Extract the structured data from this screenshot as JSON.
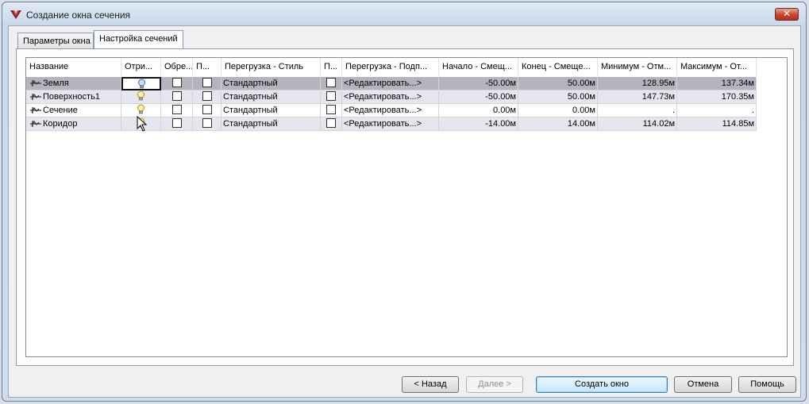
{
  "window": {
    "title": "Создание окна сечения"
  },
  "tabs": [
    {
      "label": "Параметры окна",
      "active": false
    },
    {
      "label": "Настройка сечений",
      "active": true
    }
  ],
  "table": {
    "headers": [
      "Название",
      "Отри...",
      "Обре...",
      "П...",
      "Перегрузка - Стиль",
      "П...",
      "Перегрузка - Подп...",
      "Начало - Смещ...",
      "Конец - Смеще...",
      "Минимум - Отм...",
      "Максимум - От..."
    ],
    "rows": [
      {
        "name": "Земля",
        "style": "Стандартный",
        "label": "<Редактировать...>",
        "start": "-50.00м",
        "end": "50.00м",
        "min": "128.95м",
        "max": "137.34м",
        "bulb": "on",
        "selected": true
      },
      {
        "name": "Поверхность1",
        "style": "Стандартный",
        "label": "<Редактировать...>",
        "start": "-50.00м",
        "end": "50.00м",
        "min": "147.73м",
        "max": "170.35м",
        "bulb": "on",
        "selected": false
      },
      {
        "name": "Сечение",
        "style": "Стандартный",
        "label": "<Редактировать...>",
        "start": "0.00м",
        "end": "0.00м",
        "min": ".",
        "max": ".",
        "bulb": "on",
        "selected": false
      },
      {
        "name": "Коридор",
        "style": "Стандартный",
        "label": "<Редактировать...>",
        "start": "-14.00м",
        "end": "14.00м",
        "min": "114.02м",
        "max": "114.85м",
        "bulb": "on",
        "selected": false
      }
    ]
  },
  "buttons": {
    "back": "< Назад",
    "next": "Далее >",
    "create": "Создать окно",
    "cancel": "Отмена",
    "help": "Помощь"
  },
  "icons": {
    "app": "civil-3d-logo-icon",
    "close": "close-icon",
    "row": "section-line-icon",
    "visibility": "lightbulb-icon"
  }
}
